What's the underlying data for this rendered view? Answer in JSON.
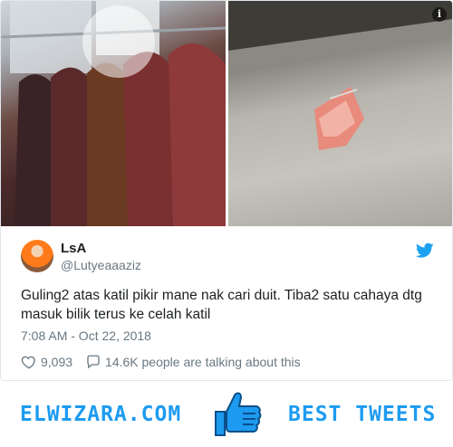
{
  "tweet": {
    "name": "LsA",
    "handle": "@Lutyeaaaziz",
    "text": "Guling2 atas katil pikir mane nak cari duit. Tiba2 satu cahaya dtg masuk bilik terus ke celah katil",
    "timestamp": "7:08 AM - Oct 22, 2018",
    "likes": "9,093",
    "talking": "14.6K people are talking about this",
    "info_icon": "i"
  },
  "banner": {
    "brand": "ELWIZARA.COM",
    "tagline": "BEST TWEETS"
  },
  "colors": {
    "accent": "#1d9bf0",
    "muted": "#697882",
    "text": "#1c2022",
    "like_outline": "#697882"
  },
  "icons": {
    "bird": "twitter-bird-icon",
    "like": "heart-icon",
    "reply": "speech-bubble-icon",
    "thumb": "thumbs-up-icon",
    "info": "info-icon"
  }
}
